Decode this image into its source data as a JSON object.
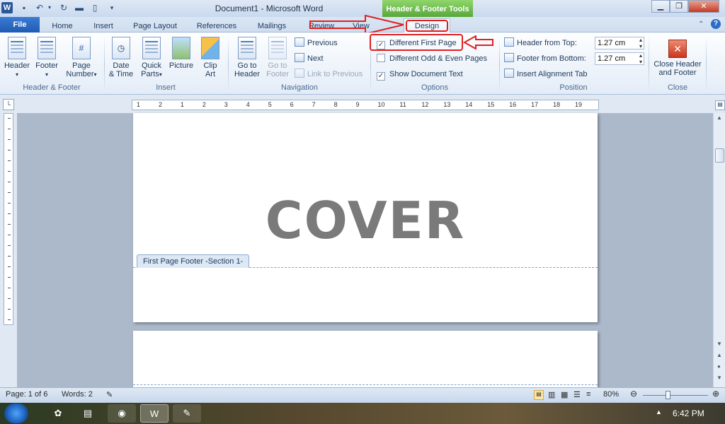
{
  "window": {
    "title": "Document1  -  Microsoft Word",
    "contextual_tab_group": "Header & Footer Tools",
    "logo_letter": "W"
  },
  "tabs": [
    {
      "label": "File"
    },
    {
      "label": "Home"
    },
    {
      "label": "Insert"
    },
    {
      "label": "Page Layout"
    },
    {
      "label": "References"
    },
    {
      "label": "Mailings"
    },
    {
      "label": "Review"
    },
    {
      "label": "View"
    },
    {
      "label": "Design"
    }
  ],
  "ribbon": {
    "header_footer_group": {
      "label": "Header & Footer",
      "header": "Header",
      "footer": "Footer",
      "page_number_line1": "Page",
      "page_number_line2": "Number"
    },
    "insert_group": {
      "label": "Insert",
      "date_time_line1": "Date",
      "date_time_line2": "& Time",
      "quick_parts_line1": "Quick",
      "quick_parts_line2": "Parts",
      "picture": "Picture",
      "clip_art_line1": "Clip",
      "clip_art_line2": "Art"
    },
    "navigation_group": {
      "label": "Navigation",
      "go_to_header_line1": "Go to",
      "go_to_header_line2": "Header",
      "go_to_footer_line1": "Go to",
      "go_to_footer_line2": "Footer",
      "previous": "Previous",
      "next": "Next",
      "link_to_previous": "Link to Previous"
    },
    "options_group": {
      "label": "Options",
      "different_first_page": "Different First Page",
      "different_first_page_checked": "✓",
      "different_odd_even": "Different Odd & Even Pages",
      "show_document_text": "Show Document Text",
      "show_document_text_checked": "✓"
    },
    "position_group": {
      "label": "Position",
      "header_from_top": "Header from Top:",
      "header_from_top_value": "1.27 cm",
      "footer_from_bottom": "Footer from Bottom:",
      "footer_from_bottom_value": "1.27 cm",
      "insert_alignment_tab": "Insert Alignment Tab"
    },
    "close_group": {
      "label": "Close",
      "close_line1": "Close Header",
      "close_line2": "and Footer"
    }
  },
  "ruler": {
    "ticks": [
      "1",
      "2",
      "1",
      "2",
      "3",
      "4",
      "5",
      "6",
      "7",
      "8",
      "9",
      "10",
      "11",
      "12",
      "13",
      "14",
      "15",
      "16",
      "17",
      "18",
      "19"
    ]
  },
  "document": {
    "cover_text": "COVER",
    "footer_label": "First Page Footer -Section 1-"
  },
  "status": {
    "page": "Page: 1 of 6",
    "words": "Words: 2",
    "zoom": "80%"
  },
  "taskbar": {
    "time": "6:42 PM"
  }
}
